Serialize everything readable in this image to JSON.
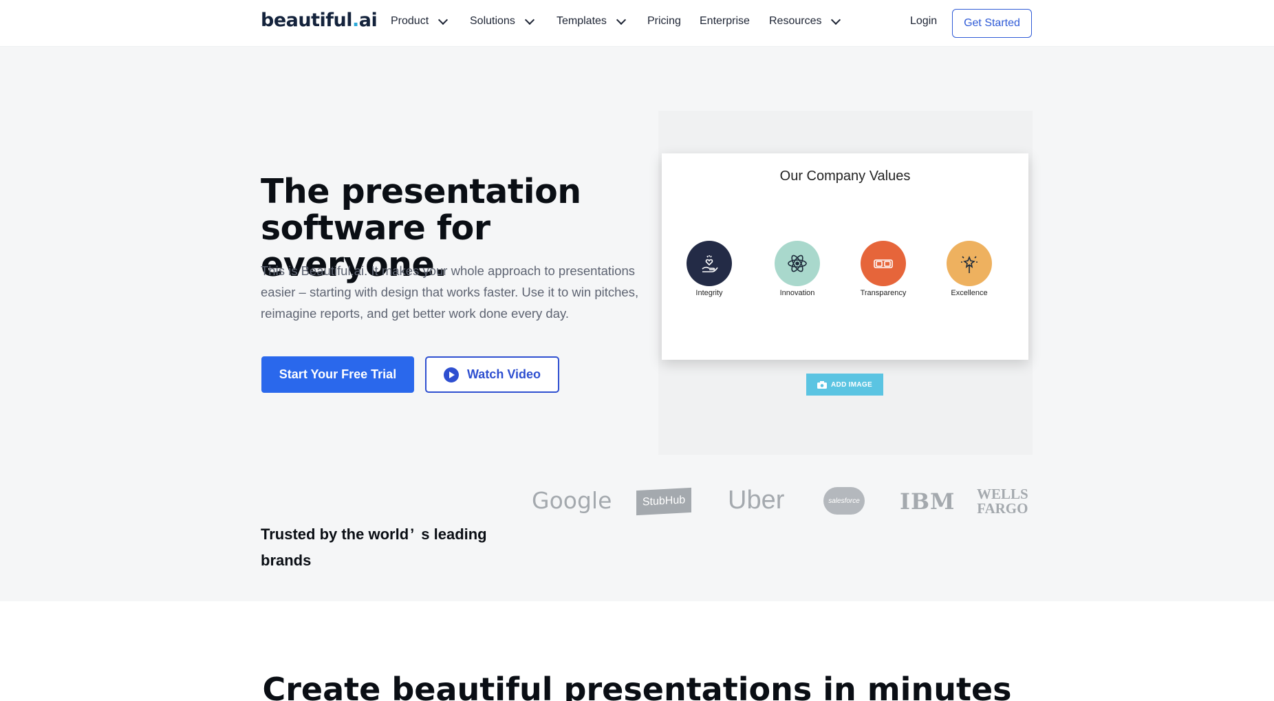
{
  "nav": {
    "logo_main": "beautiful",
    "logo_dot": ".",
    "logo_ai": "ai",
    "items": [
      {
        "label": "Product"
      },
      {
        "label": "Solutions"
      },
      {
        "label": "Templates"
      },
      {
        "label": "Pricing"
      },
      {
        "label": "Enterprise"
      },
      {
        "label": "Resources"
      }
    ],
    "login": "Login",
    "get_started": "Get Started"
  },
  "hero": {
    "title_line1": "The presentation",
    "title_line2": "software for everyone.",
    "description": "This is Beautiful.ai. It makes your whole approach to presentations easier – starting with design that works faster. Use it to win pitches, reimagine reports, and get better work done every day.",
    "primary_cta": "Start Your Free Trial",
    "secondary_cta": "Watch Video"
  },
  "slide": {
    "title": "Our Company Values",
    "values": [
      {
        "label": "Integrity",
        "color": "#232b46",
        "icon": "hand-heart-icon"
      },
      {
        "label": "Innovation",
        "color": "#a9d8cc",
        "icon": "atom-icon"
      },
      {
        "label": "Transparency",
        "color": "#e6653a",
        "icon": "glasses-icon"
      },
      {
        "label": "Excellence",
        "color": "#eeb15f",
        "icon": "sparkle-icon"
      }
    ],
    "add_image": "ADD IMAGE"
  },
  "trusted": {
    "text_part1": "Trusted by the world",
    "apostrophe": "’",
    "text_part2": "s leading brands",
    "brands": [
      "Google",
      "StubHub",
      "Uber",
      "salesforce",
      "IBM",
      "WELLS",
      "FARGO"
    ]
  },
  "section": {
    "heading": "Create beautiful presentations in minutes"
  },
  "colors": {
    "primary_blue": "#2a68ec",
    "outline_blue": "#2e4fd0",
    "hero_bg": "#f5f6f7"
  }
}
